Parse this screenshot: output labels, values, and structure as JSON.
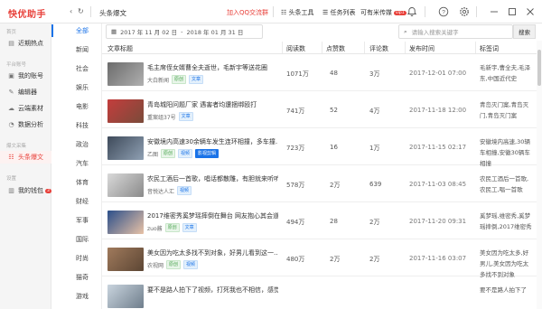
{
  "titlebar": {
    "app_name": "快优助手",
    "back_icon": "chevron-left-icon",
    "refresh_icon": "refresh-icon",
    "tab_title": "头条爆文",
    "qq_link": "加入QQ交流群",
    "toutiao_tool": "头条工具",
    "task_list": "任务列表",
    "user_name": "可有米传媒",
    "vip_badge": "vip1"
  },
  "sidebar": {
    "sections": [
      {
        "title": "首页",
        "items": [
          {
            "label": "近期热点",
            "icon": "hot-icon"
          }
        ]
      },
      {
        "title": "平台账号",
        "items": [
          {
            "label": "我的账号",
            "icon": "account-icon"
          },
          {
            "label": "编辑器",
            "icon": "editor-icon"
          },
          {
            "label": "云端素材",
            "icon": "cloud-icon"
          },
          {
            "label": "数据分析",
            "icon": "analytics-icon"
          }
        ]
      },
      {
        "title": "爆文采集",
        "items": [
          {
            "label": "头条爆文",
            "icon": "article-icon"
          }
        ]
      },
      {
        "title": "设置",
        "items": [
          {
            "label": "我的钱包",
            "icon": "wallet-icon",
            "badge": "3"
          }
        ]
      }
    ]
  },
  "categories": [
    "全部",
    "新闻",
    "社会",
    "娱乐",
    "电影",
    "科技",
    "政治",
    "汽车",
    "体育",
    "财经",
    "军事",
    "国际",
    "时尚",
    "猫奇",
    "游戏"
  ],
  "filter": {
    "date_start": "2017 年 11 月 02 日",
    "date_sep": "-",
    "date_end": "2018 年 01 月 31 日",
    "search_placeholder": "请输入搜索关键字",
    "search_button": "搜索"
  },
  "table": {
    "headers": [
      "文章标题",
      "阅读数",
      "点赞数",
      "评论数",
      "发布时间",
      "标签词"
    ],
    "rows": [
      {
        "title": "毛主席侄女婿曹全夫逝世，毛新宇等送花圈",
        "author": "大白新闻",
        "tags": [
          {
            "text": "原创",
            "style": "green"
          },
          {
            "text": "文章",
            "style": "blue"
          }
        ],
        "reads": "1071万",
        "likes": "48",
        "comments": "3万",
        "time": "2017-12-01 07:00",
        "labels": "毛新宇,曹全夫,毛泽东,中国近代史"
      },
      {
        "title": "青岛城阳问题厂家 遇害者均遭捆绑殴打",
        "author": "重案组37号",
        "tags": [
          {
            "text": "文章",
            "style": "blue"
          }
        ],
        "reads": "741万",
        "likes": "52",
        "comments": "4万",
        "time": "2017-11-18 12:00",
        "labels": "青岛灭门案,青岛灭门,青岛灭门案"
      },
      {
        "title": "安徽境内高速30余辆车发生连环相撞，多车撞…",
        "author": "乙图",
        "tags": [
          {
            "text": "原创",
            "style": "green"
          },
          {
            "text": "视频",
            "style": "blue"
          },
          {
            "text": "影视剪辑",
            "style": "solid"
          }
        ],
        "reads": "723万",
        "likes": "16",
        "comments": "1万",
        "time": "2017-11-15 02:17",
        "labels": "安徽境内高速,30辆车相撞,安徽30辆车相撞"
      },
      {
        "title": "农民工酒后一首歌，唱话都散雕，有胆就来听听",
        "author": "音悦达人汇",
        "tags": [
          {
            "text": "视频",
            "style": "blue"
          }
        ],
        "reads": "578万",
        "likes": "2万",
        "comments": "639",
        "time": "2017-11-03 08:45",
        "labels": "农民工酒后一首歌,农民工,唱一首歌"
      },
      {
        "title": "2017维密秀奚梦瑶摔倒在舞台 网友抱心其会道…",
        "author": "zuo酱",
        "tags": [
          {
            "text": "原创",
            "style": "green"
          },
          {
            "text": "文章",
            "style": "blue"
          }
        ],
        "reads": "494万",
        "likes": "28",
        "comments": "2万",
        "time": "2017-11-20 09:31",
        "labels": "奚梦瑶,维密秀,奚梦瑶摔倒,2017维密秀"
      },
      {
        "title": "美女因为吃太多找不到对象，好男儿看到这一…",
        "author": "农视网",
        "tags": [
          {
            "text": "原创",
            "style": "green"
          },
          {
            "text": "视频",
            "style": "blue"
          }
        ],
        "reads": "480万",
        "likes": "2万",
        "comments": "2万",
        "time": "2017-11-16 03:07",
        "labels": "美女因为吃太多,好男儿,美女因为吃太多找不到对象"
      },
      {
        "title": "要不是路人拍下了视频，打死我也不相信，感觉…",
        "author": "",
        "tags": [],
        "reads": "",
        "likes": "",
        "comments": "",
        "time": "",
        "labels": "要不是路人拍下了"
      }
    ]
  }
}
